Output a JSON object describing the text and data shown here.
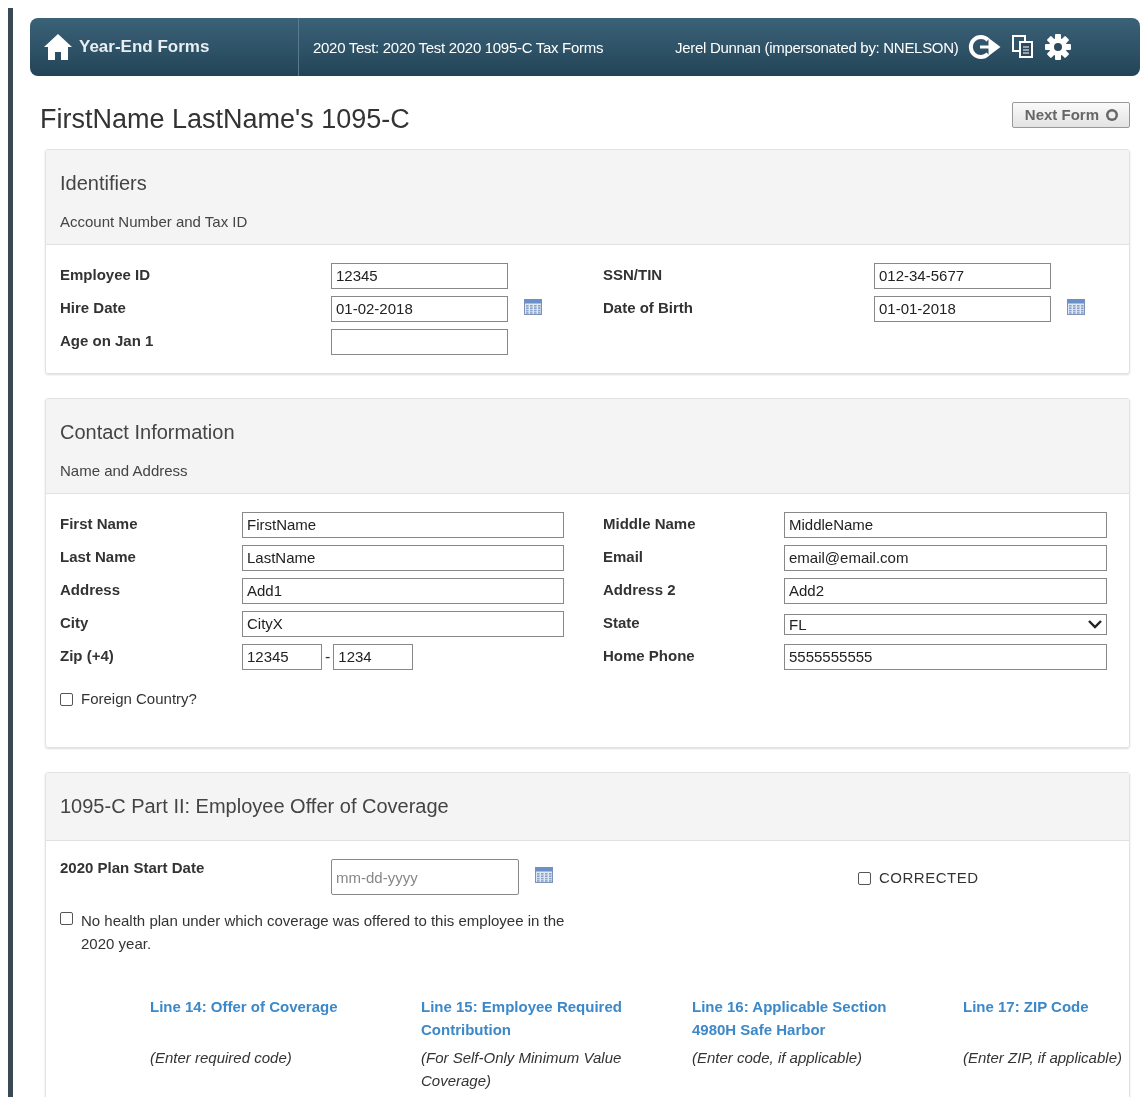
{
  "header": {
    "app_title": "Year-End Forms",
    "form_name": "2020 Test: 2020 Test 2020 1095-C Tax Forms",
    "user": "Jerel Dunnan (impersonated by: NNELSON)"
  },
  "page_title": "FirstName LastName's 1095-C",
  "next_button": "Next Form",
  "identifiers": {
    "title": "Identifiers",
    "subtitle": "Account Number and Tax ID",
    "fields": [
      {
        "kind": "text",
        "label": "Employee ID",
        "value": "12345"
      },
      {
        "kind": "text",
        "label": "SSN/TIN",
        "value": "012-34-5677"
      },
      {
        "kind": "date",
        "label": "Hire Date",
        "value": "01-02-2018"
      },
      {
        "kind": "date",
        "label": "Date of Birth",
        "value": "01-01-2018"
      },
      {
        "kind": "text",
        "label": "Age on Jan 1"
      }
    ]
  },
  "contact": {
    "title": "Contact Information",
    "subtitle": "Name and Address",
    "fields": [
      {
        "kind": "text",
        "label": "First Name",
        "value": "FirstName"
      },
      {
        "kind": "text",
        "label": "Middle Name",
        "value": "MiddleName"
      },
      {
        "kind": "text",
        "label": "Last Name",
        "value": "LastName"
      },
      {
        "kind": "text",
        "label": "Email",
        "value": "email@email.com"
      },
      {
        "kind": "text",
        "label": "Address",
        "value": "Add1"
      },
      {
        "kind": "text",
        "label": "Address 2",
        "value": "Add2"
      },
      {
        "kind": "text",
        "label": "City",
        "value": "CityX"
      },
      {
        "kind": "select",
        "label": "State",
        "value": "FL"
      },
      {
        "kind": "zip",
        "label": "Zip (+4)",
        "value": "12345",
        "separator": "-",
        "value2": "1234"
      },
      {
        "kind": "text",
        "label": "Home Phone",
        "value": "5555555555"
      }
    ],
    "foreign_country": {
      "label": "Foreign Country?",
      "checked": false
    }
  },
  "coverage": {
    "title": "1095-C Part II: Employee Offer of Coverage",
    "plan_start_date": {
      "label": "2020 Plan Start Date",
      "placeholder": "mm-dd-yyyy"
    },
    "corrected": {
      "label": "CORRECTED",
      "checked": false
    },
    "no_plan": {
      "label": "No health plan under which coverage was offered to this employee in the 2020 year.",
      "checked": false
    },
    "lines": [
      {
        "title": "Line 14: Offer of Coverage",
        "hint": "(Enter required code)"
      },
      {
        "title": "Line 15: Employee Required Contribution",
        "hint": "(For Self-Only Minimum Value Coverage)"
      },
      {
        "title": "Line 16: Applicable Section 4980H Safe Harbor",
        "hint": "(Enter code, if applicable)"
      },
      {
        "title": "Line 17: ZIP Code",
        "hint": "(Enter ZIP, if applicable)"
      }
    ]
  }
}
